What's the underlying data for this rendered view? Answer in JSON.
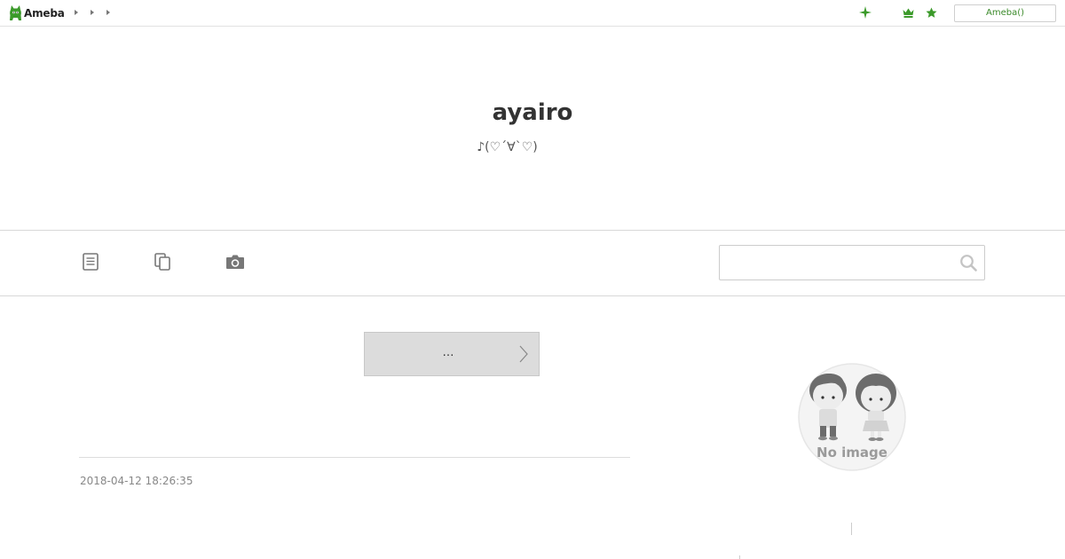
{
  "topbar": {
    "logo_text": "Ameba",
    "nav_arrows": [
      "nav-arrow-1",
      "nav-arrow-2",
      "nav-arrow-3"
    ],
    "icons": [
      "sparkle-icon",
      "crown-icon",
      "star-icon"
    ],
    "login_label": "Ameba()",
    "accent_color": "#3b9a2a"
  },
  "header": {
    "title": "ayairo",
    "description": "♪(♡´∀`♡)"
  },
  "tabs": {
    "icons": [
      "article-list-icon",
      "pages-icon",
      "camera-icon"
    ]
  },
  "search": {
    "value": "",
    "placeholder": "",
    "button_icon": "search-icon"
  },
  "main": {
    "more_label": "…",
    "post_date": "2018-04-12 18:26:35"
  },
  "sidebar": {
    "profile_image_text": "No image"
  }
}
